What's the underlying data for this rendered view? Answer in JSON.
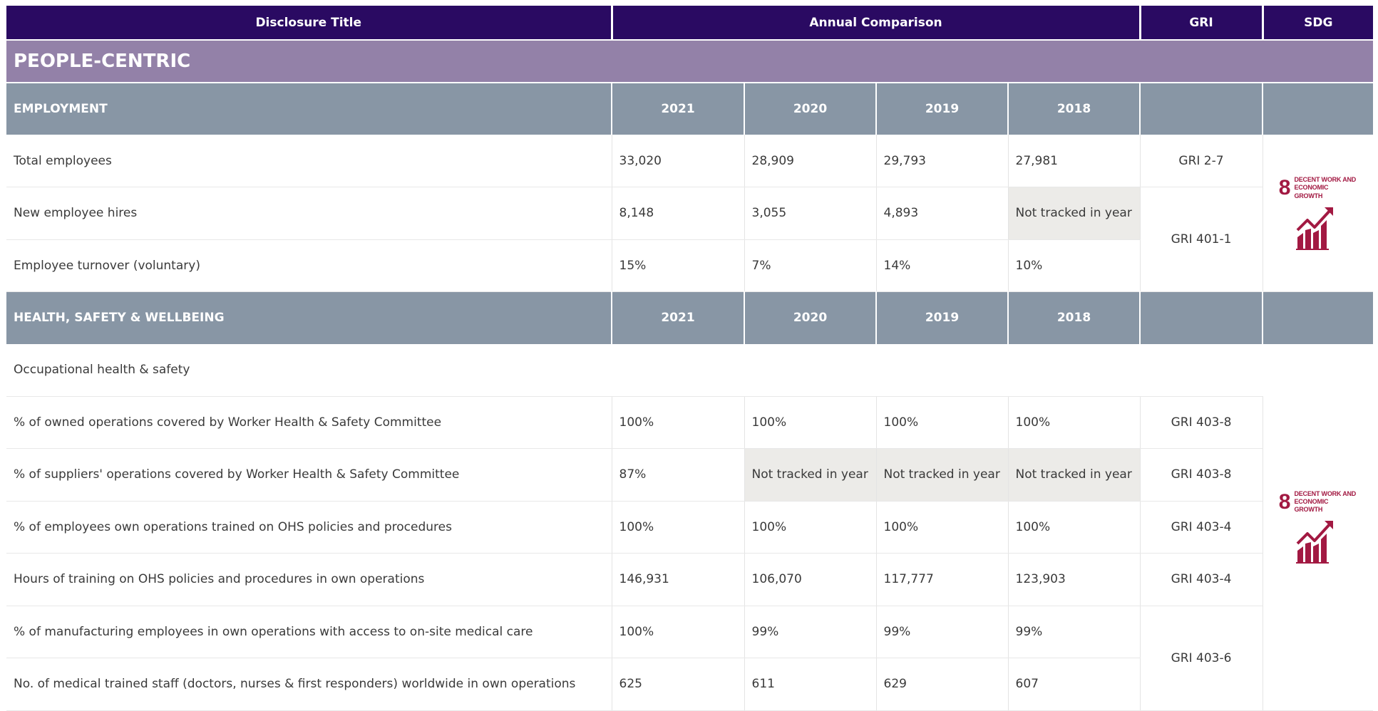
{
  "header": {
    "disclosure_title": "Disclosure Title",
    "annual_comparison": "Annual Comparison",
    "gri": "GRI",
    "sdg": "SDG"
  },
  "section_title": "PEOPLE-CENTRIC",
  "employment": {
    "title": "EMPLOYMENT",
    "years": [
      "2021",
      "2020",
      "2019",
      "2018"
    ],
    "rows": [
      {
        "label": "Total employees",
        "values": [
          "33,020",
          "28,909",
          "29,793",
          "27,981"
        ],
        "gri": "GRI 2-7"
      },
      {
        "label": "New employee hires",
        "values": [
          "8,148",
          "3,055",
          "4,893",
          "Not tracked in year"
        ],
        "gri": "GRI 401-1"
      },
      {
        "label": "Employee turnover (voluntary)",
        "values": [
          "15%",
          "7%",
          "14%",
          "10%"
        ]
      }
    ]
  },
  "health": {
    "title": "HEALTH, SAFETY & WELLBEING",
    "years": [
      "2021",
      "2020",
      "2019",
      "2018"
    ],
    "intro": "Occupational health & safety",
    "rows": [
      {
        "label": "% of owned operations covered by Worker Health & Safety Committee",
        "values": [
          "100%",
          "100%",
          "100%",
          "100%"
        ],
        "gri": "GRI 403-8"
      },
      {
        "label": "% of suppliers' operations covered by Worker Health & Safety Committee",
        "values": [
          "87%",
          "Not tracked in year",
          "Not tracked in year",
          "Not tracked in year"
        ],
        "gri": "GRI 403-8"
      },
      {
        "label": "% of employees own operations trained on OHS policies and procedures",
        "values": [
          "100%",
          "100%",
          "100%",
          "100%"
        ],
        "gri": "GRI 403-4"
      },
      {
        "label": "Hours of training on OHS policies and procedures in own operations",
        "values": [
          "146,931",
          "106,070",
          "117,777",
          "123,903"
        ],
        "gri": "GRI 403-4"
      },
      {
        "label": "% of manufacturing employees in own operations with access to on-site medical care",
        "values": [
          "100%",
          "99%",
          "99%",
          "99%"
        ],
        "gri": "GRI 403-6"
      },
      {
        "label": "No. of medical trained staff (doctors, nurses & first responders) worldwide in own operations",
        "values": [
          "625",
          "611",
          "629",
          "607"
        ]
      }
    ]
  },
  "sdg_badge": {
    "number": "8",
    "line1": "DECENT WORK AND",
    "line2": "ECONOMIC GROWTH",
    "icon": "growth-chart-icon",
    "color": "#a21942"
  },
  "colors": {
    "header_bg": "#2a0a62",
    "section_bg": "#9381a8",
    "subheader_bg": "#8896a5",
    "not_tracked_bg": "#ecebe8"
  }
}
